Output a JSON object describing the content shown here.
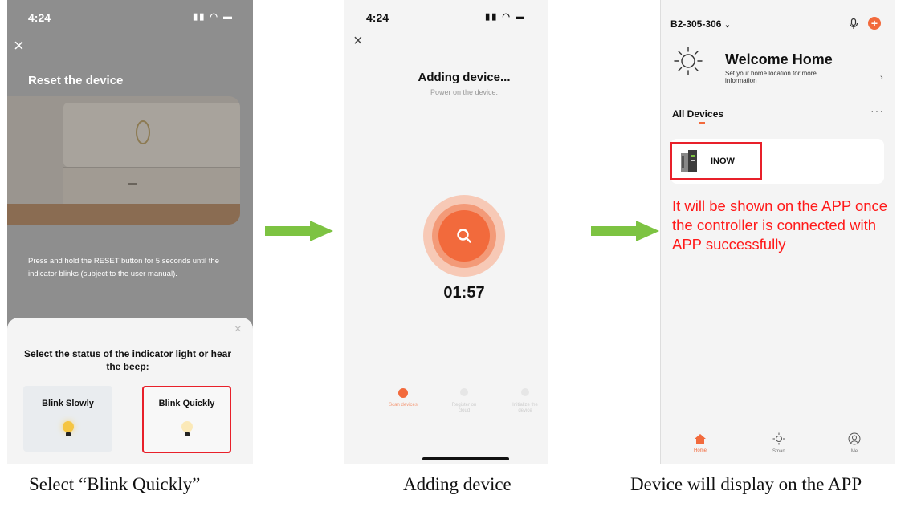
{
  "screen1": {
    "time": "4:24",
    "title": "Reset the device",
    "instruction": "Press and hold the RESET button for 5 seconds until the indicator blinks (subject to the user manual).",
    "sheet_prompt": "Select the status of the indicator light or hear the beep:",
    "option_slow": "Blink Slowly",
    "option_quick": "Blink Quickly",
    "caption": "Select “Blink Quickly”"
  },
  "screen2": {
    "time": "4:24",
    "title": "Adding device...",
    "subtitle": "Power on the device.",
    "timer": "01:57",
    "step1": "Scan devices",
    "step2": "Register on cloud",
    "step3": "Initialize the device",
    "caption": "Adding device"
  },
  "screen3": {
    "home_name": "B2-305-306",
    "welcome": "Welcome Home",
    "welcome_sub": "Set your home location for more information",
    "section": "All Devices",
    "device_name": "INOW",
    "annotation": "It will be shown on the APP once the controller is connected with APP successfully",
    "nav_home": "Home",
    "nav_smart": "Smart",
    "nav_me": "Me",
    "caption": "Device will display on the APP"
  },
  "colors": {
    "accent": "#f26a3c",
    "annotation_red": "#ff1a1a",
    "arrow_green": "#7dc342",
    "highlight_box": "#e8202a"
  }
}
